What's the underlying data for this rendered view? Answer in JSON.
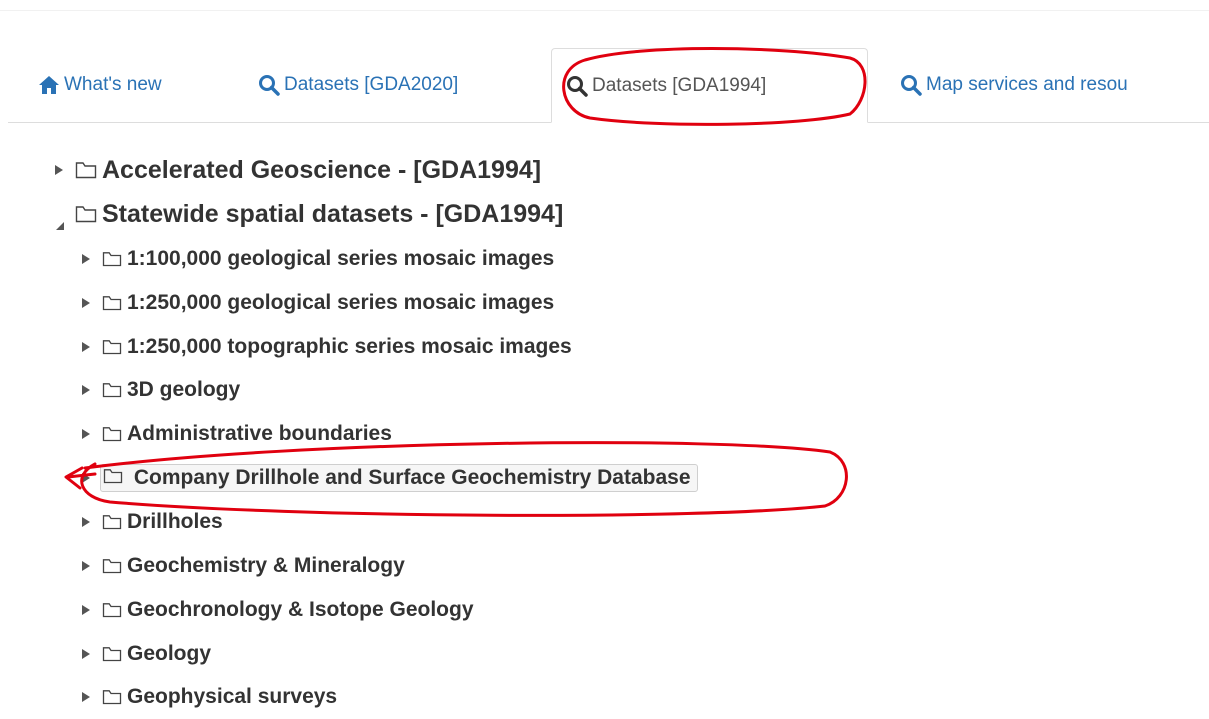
{
  "tabs": [
    {
      "label": "What's new",
      "icon": "home-icon",
      "active": false
    },
    {
      "label": "Datasets [GDA2020]",
      "icon": "search-icon",
      "active": false
    },
    {
      "label": "Datasets [GDA1994]",
      "icon": "search-icon",
      "active": true
    },
    {
      "label": "Map services and resou",
      "icon": "search-icon",
      "active": false
    }
  ],
  "tree": {
    "root_items": [
      {
        "label": "Accelerated Geoscience - [GDA1994]",
        "expanded": false
      },
      {
        "label": "Statewide spatial datasets - [GDA1994]",
        "expanded": true
      }
    ],
    "children": [
      {
        "label": "1:100,000 geological series mosaic images"
      },
      {
        "label": "1:250,000 geological series mosaic images"
      },
      {
        "label": "1:250,000 topographic series mosaic images"
      },
      {
        "label": "3D geology"
      },
      {
        "label": "Administrative boundaries"
      },
      {
        "label": "Company Drillhole and Surface Geochemistry Database",
        "selected": true
      },
      {
        "label": "Drillholes"
      },
      {
        "label": "Geochemistry & Mineralogy"
      },
      {
        "label": "Geochronology & Isotope Geology"
      },
      {
        "label": "Geology"
      },
      {
        "label": "Geophysical surveys"
      }
    ]
  },
  "colors": {
    "link": "#2a72b5",
    "annotation": "#e0000f"
  }
}
